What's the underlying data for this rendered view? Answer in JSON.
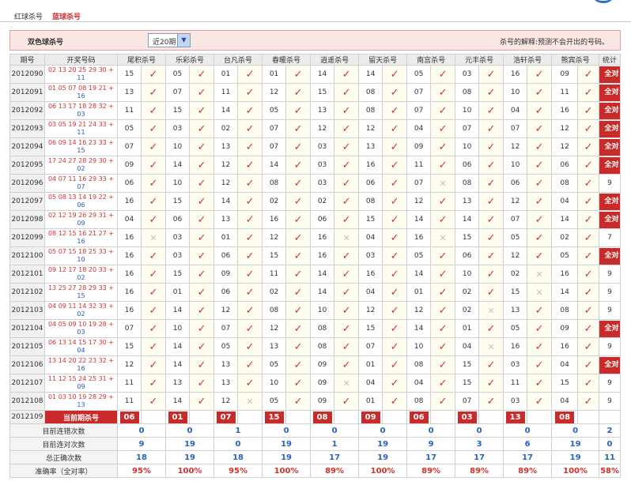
{
  "tabs": {
    "red": "红球杀号",
    "blue": "蓝球杀号"
  },
  "toolbar": {
    "title": "双色球杀号",
    "period_value": "近20期",
    "hint": "杀号的解释:预测不会开出的号码。"
  },
  "header": [
    "期号",
    "开奖号码",
    "尾积杀号",
    "乐彩杀号",
    "台凡杀号",
    "春暖杀号",
    "逍遥杀号",
    "留天杀号",
    "南宫杀号",
    "元丰杀号",
    "浩轩杀号",
    "熊宾杀号",
    "统计"
  ],
  "rows": [
    {
      "issue": "2012090",
      "red": "02 13 20 25 29 30 +",
      "blue": "11",
      "kills": [
        "15",
        "05",
        "01",
        "01",
        "14",
        "14",
        "05",
        "03",
        "16",
        "09"
      ],
      "ok": [
        1,
        1,
        1,
        1,
        1,
        1,
        1,
        1,
        1,
        1
      ],
      "stat": "全对"
    },
    {
      "issue": "2012091",
      "red": "01 05 07 08 19 21 +",
      "blue": "16",
      "kills": [
        "13",
        "07",
        "11",
        "12",
        "15",
        "08",
        "07",
        "08",
        "10",
        "11"
      ],
      "ok": [
        1,
        1,
        1,
        1,
        1,
        1,
        1,
        1,
        1,
        1
      ],
      "stat": "全对"
    },
    {
      "issue": "2012092",
      "red": "06 13 17 18 28 32 +",
      "blue": "03",
      "kills": [
        "11",
        "15",
        "14",
        "05",
        "13",
        "08",
        "07",
        "10",
        "04",
        "16"
      ],
      "ok": [
        1,
        1,
        1,
        1,
        1,
        1,
        1,
        1,
        1,
        1
      ],
      "stat": "全对"
    },
    {
      "issue": "2012093",
      "red": "03 05 19 21 24 33 +",
      "blue": "11",
      "kills": [
        "05",
        "03",
        "02",
        "07",
        "12",
        "12",
        "04",
        "07",
        "07",
        "12"
      ],
      "ok": [
        1,
        1,
        1,
        1,
        1,
        1,
        1,
        1,
        1,
        1
      ],
      "stat": "全对"
    },
    {
      "issue": "2012094",
      "red": "06 09 14 16 23 33 +",
      "blue": "15",
      "kills": [
        "07",
        "10",
        "13",
        "07",
        "03",
        "13",
        "09",
        "10",
        "12",
        "12"
      ],
      "ok": [
        1,
        1,
        1,
        1,
        1,
        1,
        1,
        1,
        1,
        1
      ],
      "stat": "全对"
    },
    {
      "issue": "2012095",
      "red": "17 24 27 28 29 30 +",
      "blue": "02",
      "kills": [
        "09",
        "14",
        "12",
        "14",
        "03",
        "16",
        "11",
        "06",
        "10",
        "06"
      ],
      "ok": [
        1,
        1,
        1,
        1,
        1,
        1,
        1,
        1,
        1,
        1
      ],
      "stat": "全对"
    },
    {
      "issue": "2012096",
      "red": "04 07 11 16 29 33 +",
      "blue": "07",
      "kills": [
        "06",
        "10",
        "12",
        "08",
        "03",
        "06",
        "07",
        "08",
        "06",
        "08"
      ],
      "ok": [
        1,
        1,
        1,
        1,
        1,
        1,
        0,
        1,
        1,
        1
      ],
      "stat": "9"
    },
    {
      "issue": "2012097",
      "red": "05 08 13 14 19 22 +",
      "blue": "06",
      "kills": [
        "16",
        "15",
        "14",
        "02",
        "02",
        "08",
        "12",
        "13",
        "12",
        "04"
      ],
      "ok": [
        1,
        1,
        1,
        1,
        1,
        1,
        1,
        1,
        1,
        1
      ],
      "stat": "全对"
    },
    {
      "issue": "2012098",
      "red": "02 12 19 26 29 31 +",
      "blue": "09",
      "kills": [
        "04",
        "06",
        "13",
        "16",
        "06",
        "15",
        "14",
        "14",
        "07",
        "14"
      ],
      "ok": [
        1,
        1,
        1,
        1,
        1,
        1,
        1,
        1,
        1,
        1
      ],
      "stat": "全对"
    },
    {
      "issue": "2012099",
      "red": "08 12 15 16 21 27 +",
      "blue": "16",
      "kills": [
        "16",
        "03",
        "01",
        "12",
        "16",
        "04",
        "16",
        "15",
        "05",
        "02"
      ],
      "ok": [
        0,
        1,
        1,
        1,
        0,
        1,
        0,
        1,
        1,
        1
      ],
      "stat": "7"
    },
    {
      "issue": "2012100",
      "red": "05 07 15 18 25 33 +",
      "blue": "10",
      "kills": [
        "16",
        "03",
        "06",
        "15",
        "16",
        "03",
        "05",
        "06",
        "12",
        "05"
      ],
      "ok": [
        1,
        1,
        1,
        1,
        1,
        1,
        1,
        1,
        1,
        1
      ],
      "stat": "全对"
    },
    {
      "issue": "2012101",
      "red": "09 12 17 18 20 33 +",
      "blue": "02",
      "kills": [
        "16",
        "15",
        "09",
        "11",
        "14",
        "16",
        "14",
        "10",
        "02",
        "16"
      ],
      "ok": [
        1,
        1,
        1,
        1,
        1,
        1,
        1,
        1,
        0,
        1
      ],
      "stat": "9"
    },
    {
      "issue": "2012102",
      "red": "13 25 27 28 29 33 +",
      "blue": "15",
      "kills": [
        "16",
        "01",
        "06",
        "02",
        "14",
        "04",
        "01",
        "02",
        "15",
        "14"
      ],
      "ok": [
        1,
        1,
        1,
        1,
        1,
        1,
        1,
        1,
        0,
        1
      ],
      "stat": "9"
    },
    {
      "issue": "2012103",
      "red": "04 09 11 14 32 33 +",
      "blue": "02",
      "kills": [
        "16",
        "14",
        "12",
        "08",
        "10",
        "12",
        "12",
        "02",
        "13",
        "08"
      ],
      "ok": [
        1,
        1,
        1,
        1,
        1,
        1,
        1,
        0,
        1,
        1
      ],
      "stat": "9"
    },
    {
      "issue": "2012104",
      "red": "04 05 09 10 19 28 +",
      "blue": "03",
      "kills": [
        "07",
        "10",
        "07",
        "12",
        "08",
        "15",
        "14",
        "01",
        "05",
        "09"
      ],
      "ok": [
        1,
        1,
        1,
        1,
        1,
        1,
        1,
        1,
        1,
        1
      ],
      "stat": "全对"
    },
    {
      "issue": "2012105",
      "red": "06 13 14 15 17 30 +",
      "blue": "04",
      "kills": [
        "15",
        "14",
        "05",
        "13",
        "08",
        "07",
        "10",
        "04",
        "16",
        "16"
      ],
      "ok": [
        1,
        1,
        1,
        1,
        1,
        1,
        1,
        0,
        1,
        1
      ],
      "stat": "9"
    },
    {
      "issue": "2012106",
      "red": "13 14 20 22 23 32 +",
      "blue": "16",
      "kills": [
        "12",
        "14",
        "13",
        "05",
        "09",
        "01",
        "08",
        "15",
        "03",
        "04"
      ],
      "ok": [
        1,
        1,
        1,
        1,
        1,
        1,
        1,
        1,
        1,
        1
      ],
      "stat": "全对"
    },
    {
      "issue": "2012107",
      "red": "11 12 15 24 25 31 +",
      "blue": "09",
      "kills": [
        "11",
        "13",
        "13",
        "10",
        "09",
        "04",
        "04",
        "15",
        "11",
        "15"
      ],
      "ok": [
        1,
        1,
        1,
        1,
        0,
        1,
        1,
        1,
        1,
        1
      ],
      "stat": "9"
    },
    {
      "issue": "2012108",
      "red": "01 03 10 19 28 29 +",
      "blue": "13",
      "kills": [
        "11",
        "14",
        "12",
        "05",
        "09",
        "01",
        "08",
        "07",
        "03",
        "04"
      ],
      "ok": [
        1,
        1,
        0,
        1,
        1,
        1,
        1,
        1,
        1,
        1
      ],
      "stat": "9"
    }
  ],
  "current": {
    "issue": "2012109",
    "label": "当前期杀号",
    "kills": [
      "06",
      "01",
      "07",
      "15",
      "08",
      "09",
      "06",
      "03",
      "13",
      "08"
    ]
  },
  "summary": [
    {
      "label": "目前连错次数",
      "values": [
        "0",
        "0",
        "1",
        "0",
        "0",
        "0",
        "0",
        "0",
        "0",
        "0"
      ],
      "stat": "2"
    },
    {
      "label": "目前连对次数",
      "values": [
        "9",
        "19",
        "0",
        "19",
        "1",
        "19",
        "9",
        "3",
        "6",
        "19"
      ],
      "stat": "0"
    },
    {
      "label": "总正确次数",
      "values": [
        "18",
        "19",
        "18",
        "19",
        "17",
        "19",
        "17",
        "17",
        "17",
        "19"
      ],
      "stat": "11"
    },
    {
      "label": "准确率（全对率）",
      "values": [
        "95%",
        "100%",
        "95%",
        "100%",
        "89%",
        "100%",
        "89%",
        "89%",
        "89%",
        "100%"
      ],
      "stat": "58%"
    }
  ],
  "marks": {
    "correct": "✓",
    "wrong": "✕"
  }
}
